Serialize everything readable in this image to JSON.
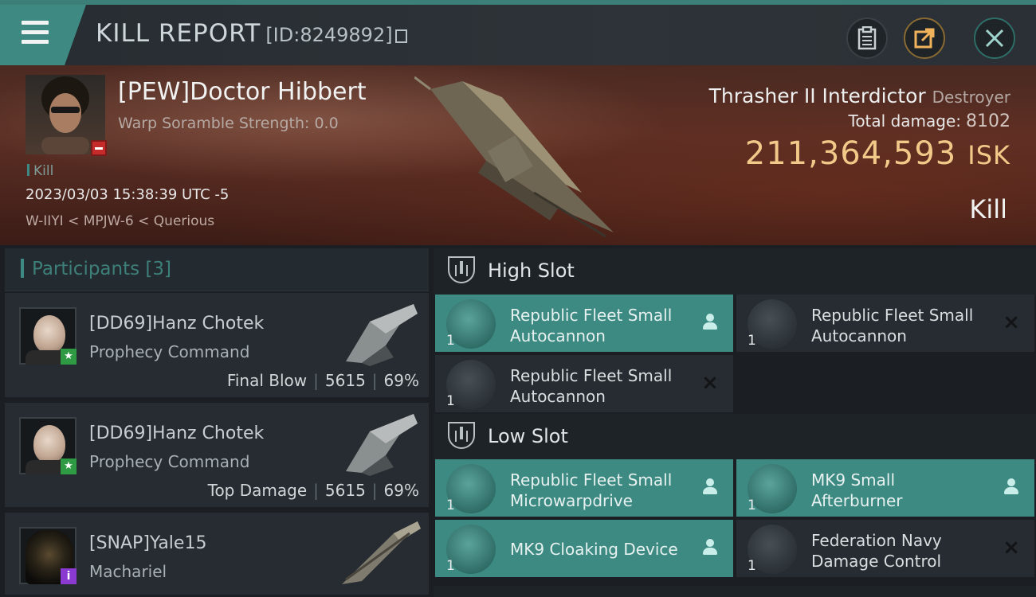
{
  "header": {
    "title": "KILL REPORT",
    "kill_id": "[ID:8249892]",
    "icons": [
      "menu-icon",
      "clipboard-icon",
      "share-icon",
      "close-icon"
    ]
  },
  "victim": {
    "name": "[PEW]Doctor Hibbert",
    "warp_scramble": "Warp Soramble Strength: 0.0",
    "tag": "Kill",
    "datetime": "2023/03/03 15:38:39 UTC -5",
    "location": "W-IIYI < MPJW-6 < Querious",
    "ship": "Thrasher II Interdictor",
    "ship_class": "Destroyer",
    "total_damage_label": "Total damage:",
    "total_damage": "8102",
    "isk_value": "211,364,593",
    "isk_unit": "ISK",
    "result": "Kill"
  },
  "participants": {
    "label": "Participants [3]",
    "rows": [
      {
        "name": "[DD69]Hanz Chotek",
        "ship": "Prophecy Command",
        "role": "Final Blow",
        "damage": "5615",
        "percent": "69%"
      },
      {
        "name": "[DD69]Hanz Chotek",
        "ship": "Prophecy Command",
        "role": "Top Damage",
        "damage": "5615",
        "percent": "69%"
      },
      {
        "name": "[SNAP]Yale15",
        "ship": "Machariel"
      }
    ]
  },
  "fitting": {
    "high_slot": {
      "label": "High Slot",
      "modules": [
        {
          "line1": "Republic Fleet Small",
          "line2": "Autocannon",
          "qty": "1",
          "status": "fitted"
        },
        {
          "line1": "Republic Fleet Small",
          "line2": "Autocannon",
          "qty": "1",
          "status": "destroyed"
        },
        {
          "line1": "Republic Fleet Small",
          "line2": "Autocannon",
          "qty": "1",
          "status": "destroyed"
        }
      ]
    },
    "low_slot": {
      "label": "Low Slot",
      "modules": [
        {
          "line1": "Republic Fleet Small",
          "line2": "Microwarpdrive",
          "qty": "1",
          "status": "fitted"
        },
        {
          "line1": "MK9 Small",
          "line2": "Afterburner",
          "qty": "1",
          "status": "fitted"
        },
        {
          "line1": "MK9 Cloaking Device",
          "line2": "",
          "qty": "1",
          "status": "fitted"
        },
        {
          "line1": "Federation Navy",
          "line2": "Damage Control",
          "qty": "1",
          "status": "destroyed"
        }
      ]
    }
  },
  "colors": {
    "accent_teal": "#3d8a82",
    "isk_gold": "#f3c989",
    "banner_red": "#5a2e24"
  }
}
